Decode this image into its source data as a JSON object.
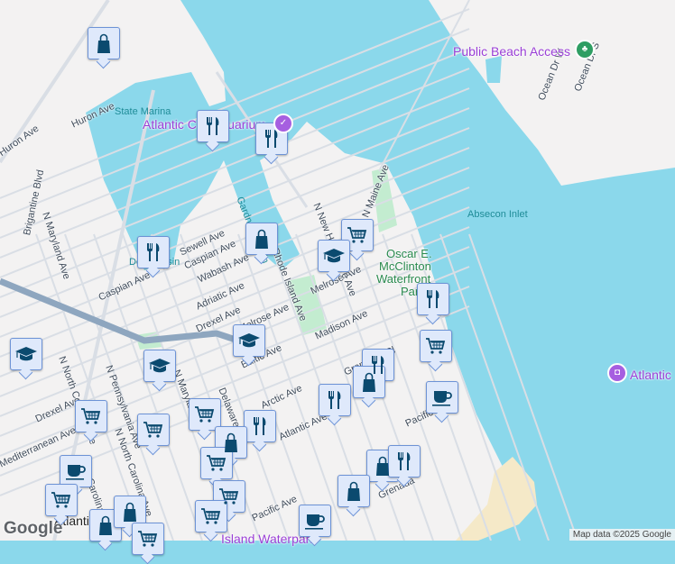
{
  "map": {
    "attribution": "Map data ©2025 Google",
    "logo": "Google",
    "colors": {
      "water": "#8bd8eb",
      "land": "#f3f2f2",
      "park": "#c3ecd0",
      "beach": "#f5e9c8",
      "marker_bg": "#dfe9fb",
      "marker_icon": "#0b4a6f",
      "poi": "#a65fe0"
    },
    "labels": {
      "water": [
        "State Marina",
        "Absecon Inlet",
        "Gardner's Basin",
        "Delta Basin"
      ],
      "park": [
        "Oscar E.",
        "McClinton",
        "Waterfront",
        "Park"
      ],
      "poi": [
        "Atlantic City Aquarium",
        "Public Beach Access",
        "Atlantic",
        "Island Waterpark"
      ],
      "city": "Atlantic City",
      "streets": [
        "Huron Ave",
        "Huron Ave",
        "Brigantine Blvd",
        "N Maryland Ave",
        "Sewell Ave",
        "Caspian Ave",
        "Wabash Ave",
        "Adriatic Ave",
        "Drexel Ave",
        "Caspian Ave",
        "Melrose Ave",
        "Melrose Ave",
        "Madison Ave",
        "Baltic Ave",
        "N Rhode Island Ave",
        "N New Hampshire Ave",
        "N Maine Ave",
        "Ocean Dr W",
        "Ocean Dr S",
        "N North Carolina Ave",
        "N Pennsylvania Ave",
        "N Maryland Ave",
        "Delaware Ave",
        "Arctic Ave",
        "Atlantic Ave",
        "Gramercy Pl",
        "Pacific Ave",
        "Pacific Ave",
        "Drexel Ave",
        "Mediterranean Ave",
        "N North Carolina Ave",
        "N Carolina Ave",
        "Grenada"
      ]
    },
    "markers": [
      "shop",
      "restaurant",
      "restaurant",
      "restaurant",
      "shop",
      "cart",
      "school",
      "restaurant",
      "cart",
      "school",
      "school",
      "school",
      "restaurant",
      "shop",
      "restaurant",
      "coffee",
      "cart",
      "cart",
      "cart",
      "restaurant",
      "shop",
      "cart",
      "coffee",
      "cart",
      "cart",
      "cart",
      "shop",
      "restaurant",
      "shop",
      "coffee",
      "shop",
      "shop",
      "cart"
    ]
  }
}
